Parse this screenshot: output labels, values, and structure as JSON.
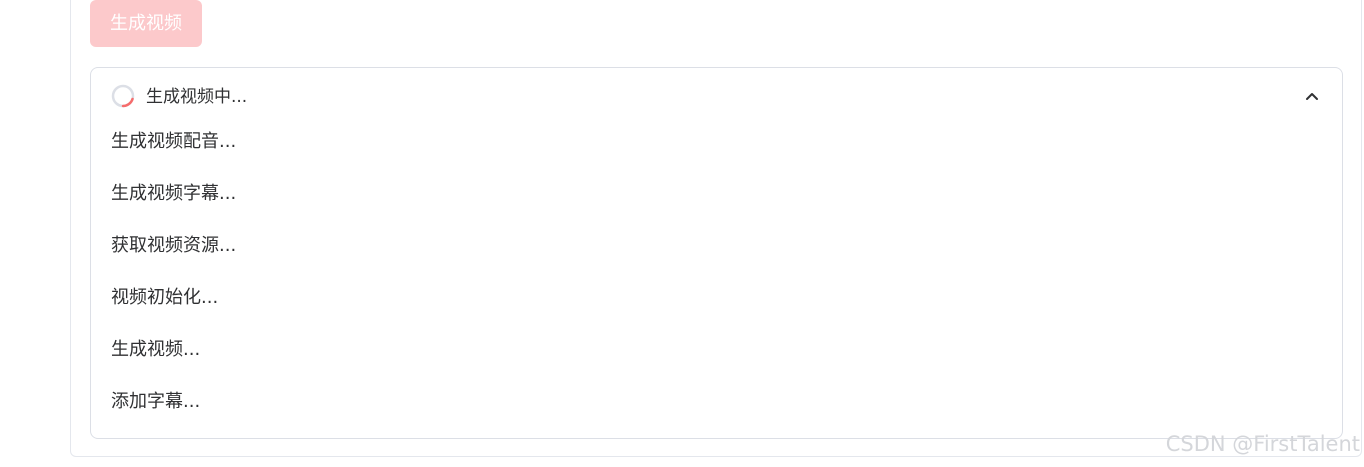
{
  "generate_button": {
    "label": "生成视频",
    "color": "#fcc9cb"
  },
  "progress_panel": {
    "header_label": "生成视频中...",
    "spinner_icon": "loading-spinner-icon",
    "toggle_icon": "chevron-up-icon",
    "expanded": true,
    "steps": [
      {
        "label": "生成视频配音..."
      },
      {
        "label": "生成视频字幕..."
      },
      {
        "label": "获取视频资源..."
      },
      {
        "label": "视频初始化..."
      },
      {
        "label": "生成视频..."
      },
      {
        "label": "添加字幕..."
      }
    ]
  },
  "watermark": {
    "text": "CSDN @FirstTalent"
  },
  "colors": {
    "accent": "#f56c6c",
    "button_disabled": "#fcc9cb",
    "border": "#dcdfe6",
    "text": "#303133"
  }
}
